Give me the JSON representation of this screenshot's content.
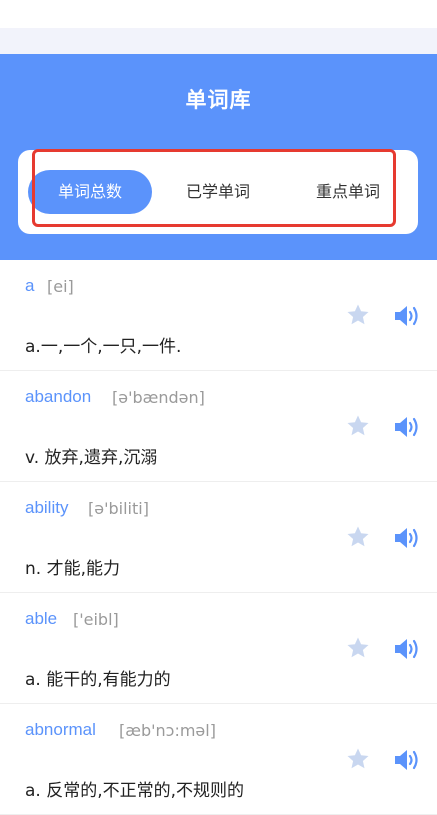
{
  "header": {
    "title": "单词库"
  },
  "tabs": [
    {
      "label": "单词总数"
    },
    {
      "label": "已学单词"
    },
    {
      "label": "重点单词"
    }
  ],
  "words": [
    {
      "word": "a",
      "phonetic": "[ei]",
      "meaning": "a.一,一个,一只,一件."
    },
    {
      "word": "abandon",
      "phonetic": "[ə'bændən]",
      "meaning": "v. 放弃,遗弃,沉溺"
    },
    {
      "word": "ability",
      "phonetic": "[ə'biliti]",
      "meaning": "n. 才能,能力"
    },
    {
      "word": "able",
      "phonetic": "['eibl]",
      "meaning": "a. 能干的,有能力的"
    },
    {
      "word": "abnormal",
      "phonetic": "[æb'nɔ:məl]",
      "meaning": "a. 反常的,不正常的,不规则的"
    }
  ],
  "colors": {
    "accent": "#5b93fb",
    "highlight": "#e63a30",
    "star": "#c9d7f0"
  },
  "icons": {
    "favorite": "star-icon",
    "pronounce": "speaker-icon"
  }
}
